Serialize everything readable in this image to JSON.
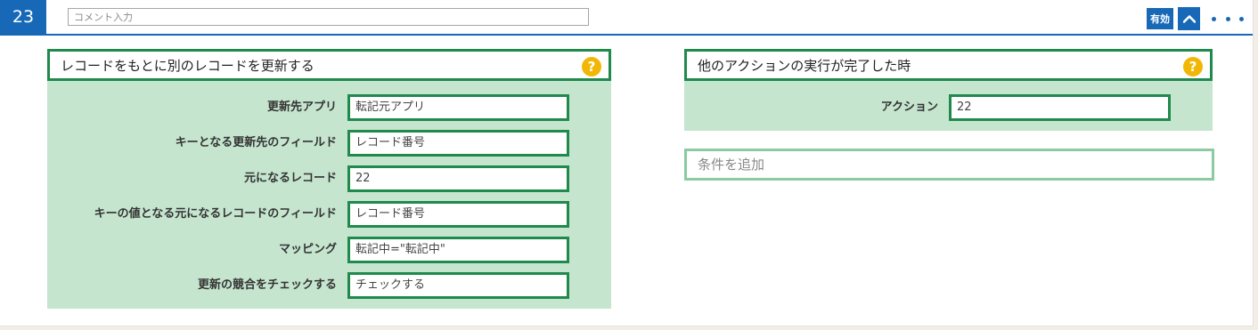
{
  "header": {
    "step_number": "23",
    "comment_placeholder": "コメント入力",
    "enabled_label": "有効",
    "accent_color": "#1769b8"
  },
  "left_panel": {
    "title": "レコードをもとに別のレコードを更新する",
    "help": "?",
    "fields": [
      {
        "label": "更新先アプリ",
        "value": "転記元アプリ"
      },
      {
        "label": "キーとなる更新先のフィールド",
        "value": "レコード番号"
      },
      {
        "label": "元になるレコード",
        "value": "22"
      },
      {
        "label": "キーの値となる元になるレコードのフィールド",
        "value": "レコード番号"
      },
      {
        "label": "マッピング",
        "value": "転記中=\"転記中\""
      },
      {
        "label": "更新の競合をチェックする",
        "value": "チェックする"
      }
    ]
  },
  "right_panel": {
    "title": "他のアクションの実行が完了した時",
    "help": "?",
    "fields": [
      {
        "label": "アクション",
        "value": "22"
      }
    ],
    "add_condition": "条件を追加"
  },
  "colors": {
    "panel_border": "#1f8a4c",
    "panel_body": "#c5e5cf",
    "help_icon": "#f2b705"
  }
}
